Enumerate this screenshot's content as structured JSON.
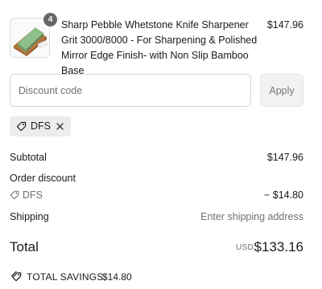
{
  "product": {
    "image_icon": "whetstone-sharpener-image",
    "quantity": "4",
    "name": "Sharp Pebble Whetstone Knife Sharpener Grit 3000/8000 - For Sharpening & Polished Mirror Edge Finish- with Non Slip Bamboo Base",
    "price": "$147.96"
  },
  "discount": {
    "placeholder": "Discount code",
    "apply_label": "Apply",
    "applied_code": "DFS",
    "tag_icon": "tag-icon",
    "remove_icon": "close-icon"
  },
  "summary": {
    "subtotal_label": "Subtotal",
    "subtotal_value": "$147.96",
    "order_discount_label": "Order discount",
    "discount_code": "DFS",
    "discount_value": "− $14.80",
    "shipping_label": "Shipping",
    "shipping_value": "Enter shipping address",
    "total_label": "Total",
    "total_currency": "USD",
    "total_value": "$133.16",
    "savings_label": "TOTAL SAVINGS",
    "savings_value": "$14.80"
  },
  "colors": {
    "text": "#1a1a1a",
    "muted": "#707070",
    "badge": "#666666",
    "pill_bg": "#ececec",
    "button_bg": "#f2f2f2"
  }
}
